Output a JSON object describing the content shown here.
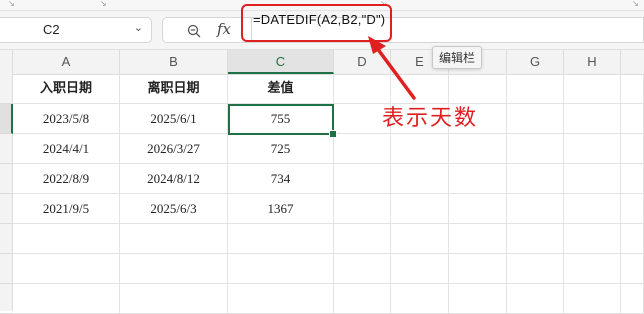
{
  "namebox": {
    "value": "C2"
  },
  "formula_bar": {
    "formula": "=DATEDIF(A2,B2,\"D\")",
    "fx_label": "fx"
  },
  "tooltip": {
    "text": "编辑栏"
  },
  "annotation": {
    "text": "表示天数",
    "color": "#e02020"
  },
  "columns": [
    "A",
    "B",
    "C",
    "D",
    "E",
    "F",
    "G",
    "H"
  ],
  "active_column": "C",
  "table": {
    "headers": [
      "入职日期",
      "离职日期",
      "差值"
    ],
    "rows": [
      [
        "2023/5/8",
        "2025/6/1",
        "755"
      ],
      [
        "2024/4/1",
        "2026/3/27",
        "725"
      ],
      [
        "2022/8/9",
        "2024/8/12",
        "734"
      ],
      [
        "2021/9/5",
        "2025/6/3",
        "1367"
      ]
    ]
  },
  "colors": {
    "accent": "#1e7145",
    "highlight": "#e02020"
  }
}
